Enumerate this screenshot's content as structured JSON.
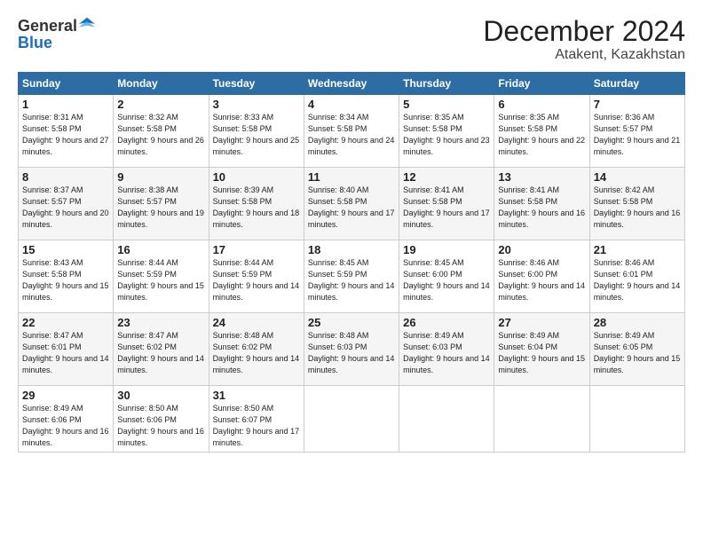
{
  "logo": {
    "general": "General",
    "blue": "Blue"
  },
  "title": "December 2024",
  "location": "Atakent, Kazakhstan",
  "days_header": [
    "Sunday",
    "Monday",
    "Tuesday",
    "Wednesday",
    "Thursday",
    "Friday",
    "Saturday"
  ],
  "weeks": [
    [
      {
        "day": "1",
        "sunrise": "8:31 AM",
        "sunset": "5:58 PM",
        "daylight": "9 hours and 27 minutes."
      },
      {
        "day": "2",
        "sunrise": "8:32 AM",
        "sunset": "5:58 PM",
        "daylight": "9 hours and 26 minutes."
      },
      {
        "day": "3",
        "sunrise": "8:33 AM",
        "sunset": "5:58 PM",
        "daylight": "9 hours and 25 minutes."
      },
      {
        "day": "4",
        "sunrise": "8:34 AM",
        "sunset": "5:58 PM",
        "daylight": "9 hours and 24 minutes."
      },
      {
        "day": "5",
        "sunrise": "8:35 AM",
        "sunset": "5:58 PM",
        "daylight": "9 hours and 23 minutes."
      },
      {
        "day": "6",
        "sunrise": "8:35 AM",
        "sunset": "5:58 PM",
        "daylight": "9 hours and 22 minutes."
      },
      {
        "day": "7",
        "sunrise": "8:36 AM",
        "sunset": "5:57 PM",
        "daylight": "9 hours and 21 minutes."
      }
    ],
    [
      {
        "day": "8",
        "sunrise": "8:37 AM",
        "sunset": "5:57 PM",
        "daylight": "9 hours and 20 minutes."
      },
      {
        "day": "9",
        "sunrise": "8:38 AM",
        "sunset": "5:57 PM",
        "daylight": "9 hours and 19 minutes."
      },
      {
        "day": "10",
        "sunrise": "8:39 AM",
        "sunset": "5:58 PM",
        "daylight": "9 hours and 18 minutes."
      },
      {
        "day": "11",
        "sunrise": "8:40 AM",
        "sunset": "5:58 PM",
        "daylight": "9 hours and 17 minutes."
      },
      {
        "day": "12",
        "sunrise": "8:41 AM",
        "sunset": "5:58 PM",
        "daylight": "9 hours and 17 minutes."
      },
      {
        "day": "13",
        "sunrise": "8:41 AM",
        "sunset": "5:58 PM",
        "daylight": "9 hours and 16 minutes."
      },
      {
        "day": "14",
        "sunrise": "8:42 AM",
        "sunset": "5:58 PM",
        "daylight": "9 hours and 16 minutes."
      }
    ],
    [
      {
        "day": "15",
        "sunrise": "8:43 AM",
        "sunset": "5:58 PM",
        "daylight": "9 hours and 15 minutes."
      },
      {
        "day": "16",
        "sunrise": "8:44 AM",
        "sunset": "5:59 PM",
        "daylight": "9 hours and 15 minutes."
      },
      {
        "day": "17",
        "sunrise": "8:44 AM",
        "sunset": "5:59 PM",
        "daylight": "9 hours and 14 minutes."
      },
      {
        "day": "18",
        "sunrise": "8:45 AM",
        "sunset": "5:59 PM",
        "daylight": "9 hours and 14 minutes."
      },
      {
        "day": "19",
        "sunrise": "8:45 AM",
        "sunset": "6:00 PM",
        "daylight": "9 hours and 14 minutes."
      },
      {
        "day": "20",
        "sunrise": "8:46 AM",
        "sunset": "6:00 PM",
        "daylight": "9 hours and 14 minutes."
      },
      {
        "day": "21",
        "sunrise": "8:46 AM",
        "sunset": "6:01 PM",
        "daylight": "9 hours and 14 minutes."
      }
    ],
    [
      {
        "day": "22",
        "sunrise": "8:47 AM",
        "sunset": "6:01 PM",
        "daylight": "9 hours and 14 minutes."
      },
      {
        "day": "23",
        "sunrise": "8:47 AM",
        "sunset": "6:02 PM",
        "daylight": "9 hours and 14 minutes."
      },
      {
        "day": "24",
        "sunrise": "8:48 AM",
        "sunset": "6:02 PM",
        "daylight": "9 hours and 14 minutes."
      },
      {
        "day": "25",
        "sunrise": "8:48 AM",
        "sunset": "6:03 PM",
        "daylight": "9 hours and 14 minutes."
      },
      {
        "day": "26",
        "sunrise": "8:49 AM",
        "sunset": "6:03 PM",
        "daylight": "9 hours and 14 minutes."
      },
      {
        "day": "27",
        "sunrise": "8:49 AM",
        "sunset": "6:04 PM",
        "daylight": "9 hours and 15 minutes."
      },
      {
        "day": "28",
        "sunrise": "8:49 AM",
        "sunset": "6:05 PM",
        "daylight": "9 hours and 15 minutes."
      }
    ],
    [
      {
        "day": "29",
        "sunrise": "8:49 AM",
        "sunset": "6:06 PM",
        "daylight": "9 hours and 16 minutes."
      },
      {
        "day": "30",
        "sunrise": "8:50 AM",
        "sunset": "6:06 PM",
        "daylight": "9 hours and 16 minutes."
      },
      {
        "day": "31",
        "sunrise": "8:50 AM",
        "sunset": "6:07 PM",
        "daylight": "9 hours and 17 minutes."
      },
      null,
      null,
      null,
      null
    ]
  ],
  "labels": {
    "sunrise": "Sunrise:",
    "sunset": "Sunset:",
    "daylight": "Daylight:"
  }
}
